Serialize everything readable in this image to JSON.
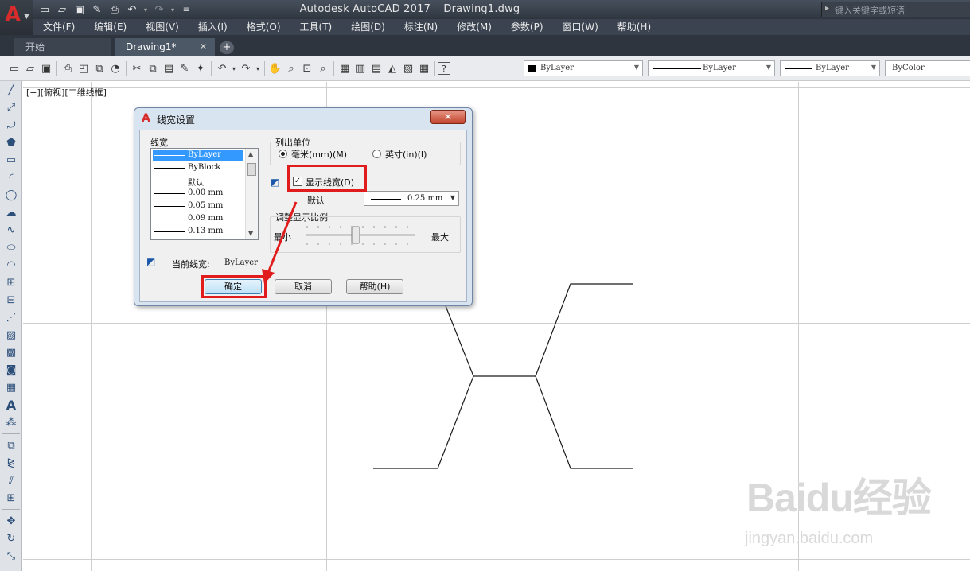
{
  "window": {
    "app_name": "Autodesk AutoCAD 2017",
    "doc_name": "Drawing1.dwg",
    "search_placeholder": "键入关键字或短语",
    "logo_letter": "A"
  },
  "menu": {
    "items": [
      "文件(F)",
      "编辑(E)",
      "视图(V)",
      "插入(I)",
      "格式(O)",
      "工具(T)",
      "绘图(D)",
      "标注(N)",
      "修改(M)",
      "参数(P)",
      "窗口(W)",
      "帮助(H)"
    ]
  },
  "tabs": {
    "start": "开始",
    "drawing": "Drawing1*",
    "close_glyph": "✕",
    "add_glyph": "+"
  },
  "properties": {
    "color": "ByLayer",
    "linetype": "ByLayer",
    "lineweight": "ByLayer",
    "plotstyle": "ByColor"
  },
  "viewport": {
    "label": "[−][俯视][二维线框]"
  },
  "dialog": {
    "title": "线宽设置",
    "close_glyph": "✕",
    "lineweights_group": "线宽",
    "lineweights": [
      {
        "label": "ByLayer",
        "selected": true
      },
      {
        "label": "ByBlock",
        "selected": false
      },
      {
        "label": "默认",
        "selected": false
      },
      {
        "label": "0.00 mm",
        "selected": false
      },
      {
        "label": "0.05 mm",
        "selected": false
      },
      {
        "label": "0.09 mm",
        "selected": false
      },
      {
        "label": "0.13 mm",
        "selected": false
      }
    ],
    "units_group": "列出单位",
    "unit_mm": "毫米(mm)(M)",
    "unit_in": "英寸(in)(I)",
    "unit_selected": "mm",
    "display_lineweight_label": "显示线宽(D)",
    "display_lineweight_checked": true,
    "default_label": "默认",
    "default_value": "0.25 mm",
    "scale_group": "调整显示比例",
    "scale_min": "最小",
    "scale_max": "最大",
    "scale_position": 0.45,
    "current_label": "当前线宽:",
    "current_value": "ByLayer",
    "ok": "确定",
    "cancel": "取消",
    "help": "帮助(H)"
  },
  "colors": {
    "highlight": "#e01c1c",
    "selection": "#3399ff",
    "title_bar": "#3b4350"
  },
  "watermark": {
    "main": "Baidu经验",
    "sub": "jingyan.baidu.com"
  }
}
